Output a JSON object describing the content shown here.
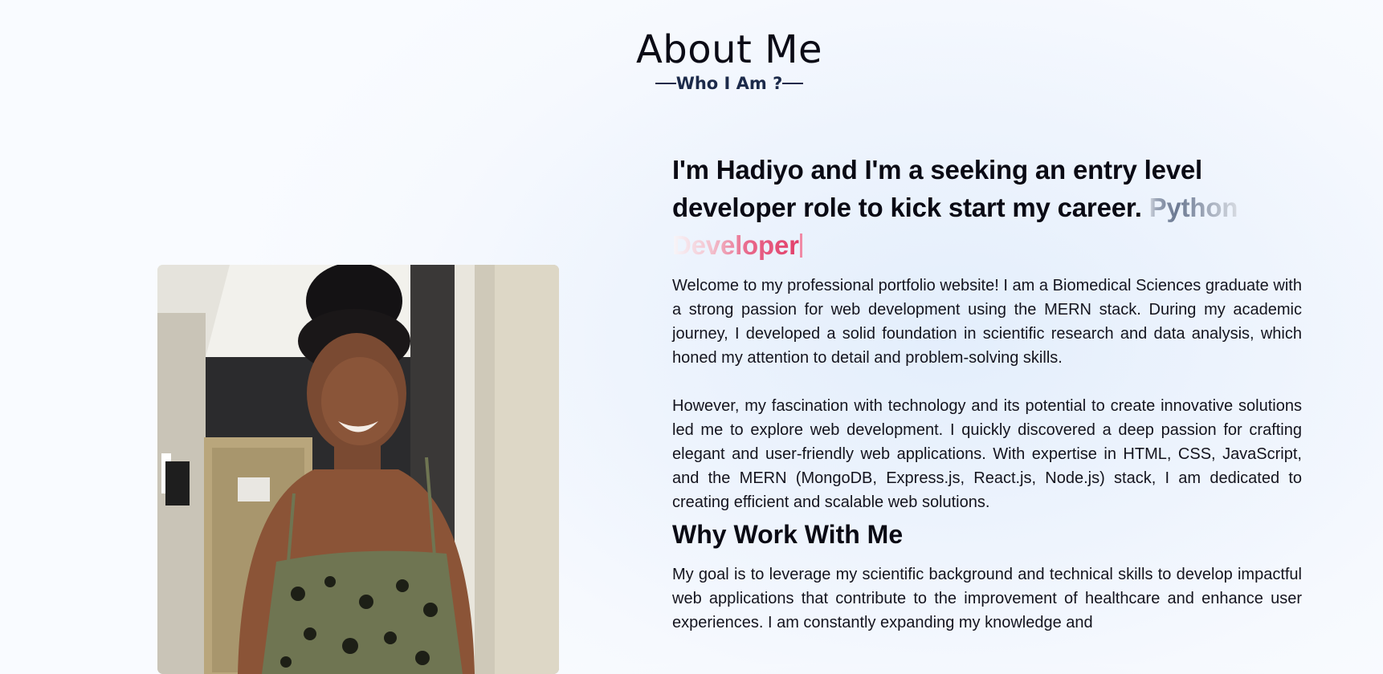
{
  "header": {
    "title": "About Me",
    "subtitle": "Who I Am ?"
  },
  "photo": {
    "alt": "Portrait photo",
    "icon": "person-photo"
  },
  "about": {
    "intro": "I'm Hadiyo and I'm a seeking an entry level developer role to kick start my career.",
    "typed_part1": "Python",
    "typed_part2": "Developer",
    "paragraph1": "Welcome to my professional portfolio website! I am a Biomedical Sciences graduate with a strong passion for web development using the MERN stack. During my academic journey, I developed a solid foundation in scientific research and data analysis, which honed my attention to detail and problem-solving skills.",
    "paragraph2": "However, my fascination with technology and its potential to create innovative solutions led me to explore web development. I quickly discovered a deep passion for crafting elegant and user-friendly web applications. With expertise in HTML, CSS, JavaScript, and the MERN (MongoDB, Express.js, React.js, Node.js) stack, I am dedicated to creating efficient and scalable web solutions.",
    "why_title": "Why Work With Me",
    "paragraph3": "My goal is to leverage my scientific background and technical skills to develop impactful web applications that contribute to the improvement of healthcare and enhance user experiences. I am constantly expanding my knowledge and"
  },
  "colors": {
    "accent_pink": "#e23f6a",
    "subtitle_navy": "#1c2a4a"
  }
}
